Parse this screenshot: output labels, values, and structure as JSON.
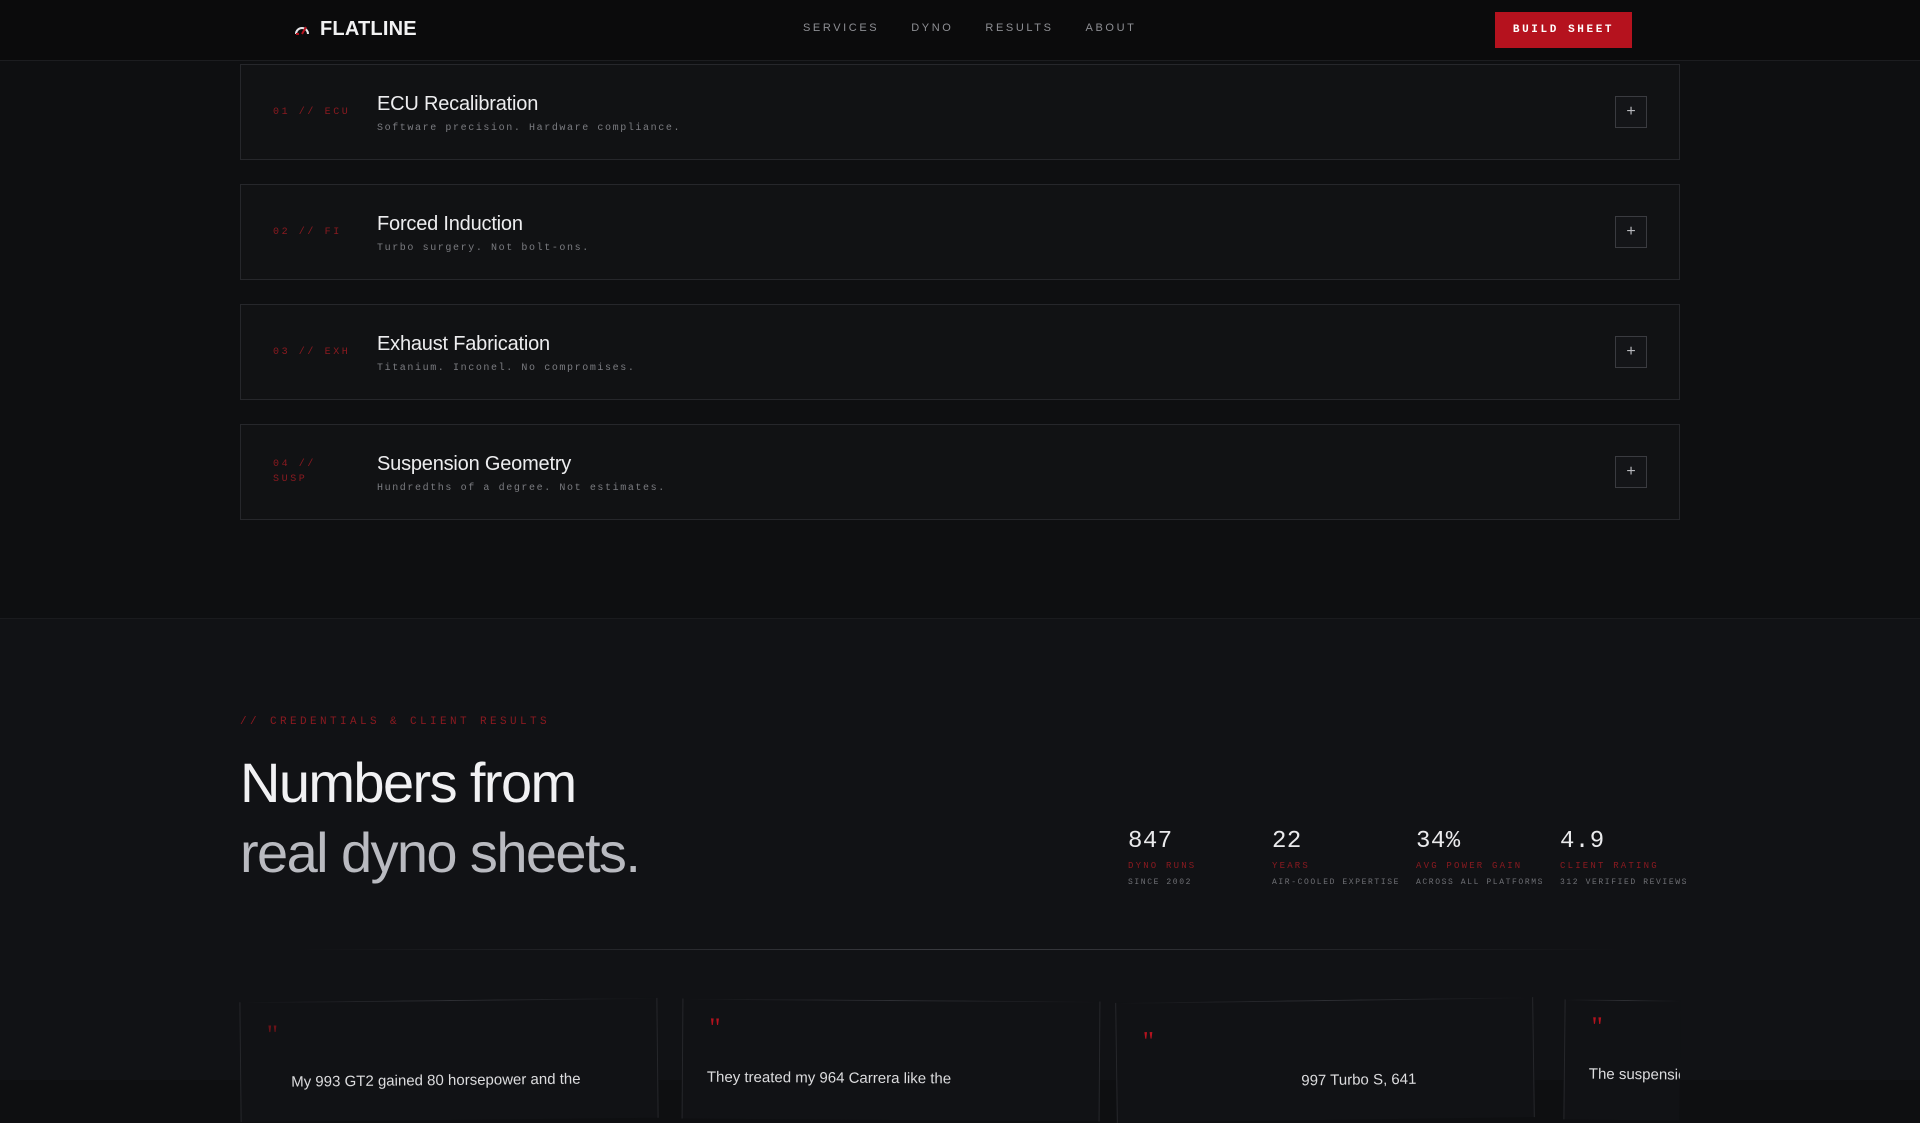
{
  "nav": {
    "brand": "FLATLINE",
    "links": [
      "SERVICES",
      "DYNO",
      "RESULTS",
      "ABOUT"
    ],
    "cta": "BUILD SHEET"
  },
  "services": [
    {
      "code": "01 // ECU",
      "title": "ECU Recalibration",
      "subtitle": "Software precision. Hardware compliance."
    },
    {
      "code": "02 // FI",
      "title": "Forced Induction",
      "subtitle": "Turbo surgery. Not bolt-ons."
    },
    {
      "code": "03 // EXH",
      "title": "Exhaust Fabrication",
      "subtitle": "Titanium. Inconel. No compromises."
    },
    {
      "code_line1": "04 //",
      "code_line2": "SUSP",
      "title": "Suspension Geometry",
      "subtitle": "Hundredths of a degree. Not estimates."
    }
  ],
  "plus_glyph": "+",
  "credentials": {
    "eyebrow": "// CREDENTIALS & CLIENT RESULTS",
    "headline_line1": "Numbers from",
    "headline_line2": "real dyno sheets.",
    "stats": [
      {
        "value": "847",
        "label": "DYNO RUNS",
        "sub": "SINCE 2002"
      },
      {
        "value": "22",
        "label": "YEARS",
        "sub": "AIR-COOLED EXPERTISE"
      },
      {
        "value": "34%",
        "label": "AVG POWER GAIN",
        "sub": "ACROSS ALL PLATFORMS"
      },
      {
        "value": "4.9",
        "label": "CLIENT RATING",
        "sub": "312 VERIFIED REVIEWS"
      }
    ]
  },
  "testimonials": [
    {
      "quote_mark": "\"",
      "text": "My 993 GT2 gained 80 horsepower and the"
    },
    {
      "quote_mark": "\"",
      "text": "They treated my 964 Carrera like the"
    },
    {
      "quote_mark": "\"",
      "text": "997 Turbo S, 641"
    },
    {
      "quote_mark": "\"",
      "text": "The suspension"
    }
  ],
  "colors": {
    "accent": "#b5121e",
    "background": "#0e0f11",
    "panel": "#111214"
  }
}
